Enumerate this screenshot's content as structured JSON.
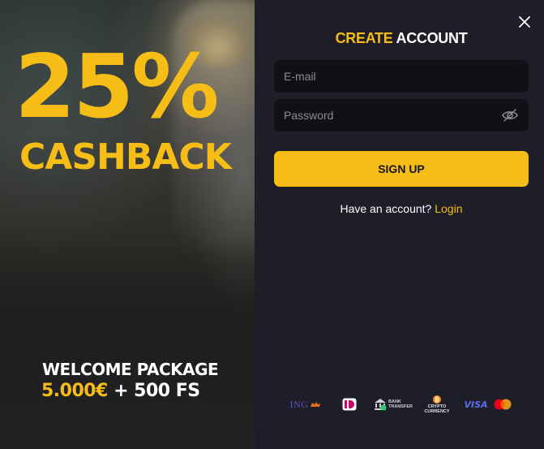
{
  "promo": {
    "percent": "25%",
    "cashback": "CASHBACK",
    "welcome_title": "WELCOME PACKAGE",
    "amount": "5.000€",
    "bonus": " + 500 FS"
  },
  "modal": {
    "title_accent": "CREATE",
    "title_rest": " ACCOUNT",
    "close_icon": "close-icon",
    "email_placeholder": "E-mail",
    "password_placeholder": "Password",
    "eye_icon": "eye-off-icon",
    "signup_label": "SIGN UP",
    "have_account_text": "Have an account? ",
    "login_link": "Login"
  },
  "payments": {
    "ing_label": "ING",
    "bank_label_1": "BANK",
    "bank_label_2": "TRANSFER",
    "crypto_label_1": "CRYPTO",
    "crypto_label_2": "CURRENCY",
    "visa_label": "VISA"
  },
  "colors": {
    "accent": "#f6bd17",
    "panel_bg": "#1d1e27",
    "input_bg": "#101117"
  }
}
